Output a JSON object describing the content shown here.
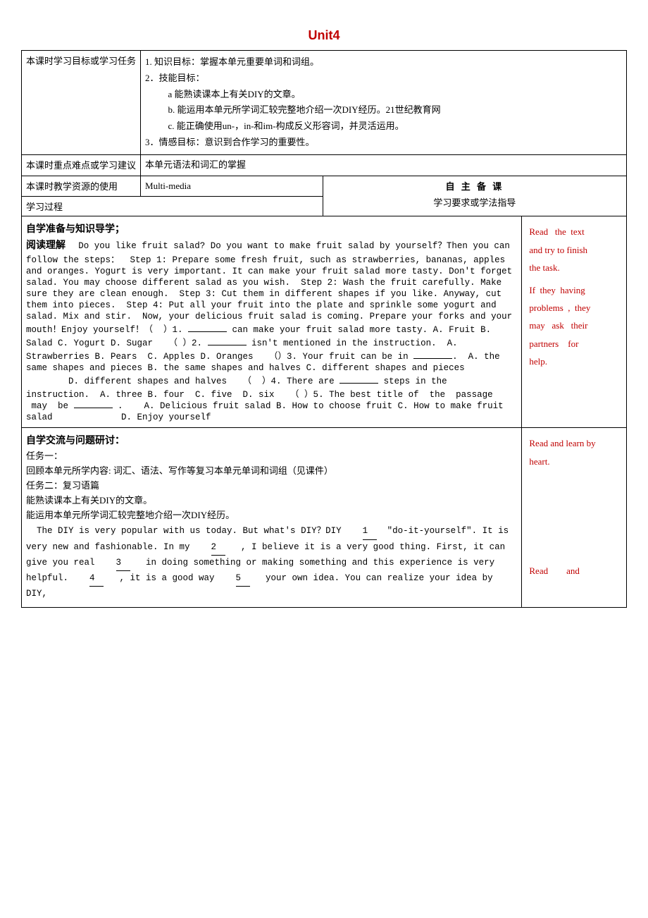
{
  "title": "Unit4",
  "table": {
    "row1": {
      "label": "本课时学习目标或学习任务",
      "content_lines": [
        "1. 知识目标：掌握本单元重要单词和词组。",
        "2．技能目标：",
        "a    能熟读课本上有关DIY的文章。",
        "b.   能运用本单元所学词汇较完整地介绍一次DIY经历。21世纪教育网",
        "c.   能正确使用un-，in-和im-构成反义形容词，并灵活运用。",
        "3．情感目标：意识到合作学习的重要性。"
      ]
    },
    "row2": {
      "label": "本课时重点难点或学习建议",
      "content": "本单元语法和词汇的掌握"
    },
    "row3": {
      "label": "本课时教学资源的使用",
      "content": "Multi-media",
      "right_label": "自 主 备 课",
      "right_sublabel": "学习要求或学法指导"
    },
    "row4": {
      "label": "学习过程"
    },
    "section1_heading": "自学准备与知识导学；",
    "section1_sub": "阅读理解",
    "section1_text": "Do you like fruit salad? Do you want to make fruit salad by yourself？Then you can follow the steps：  Step 1: Prepare some fresh fruit, such as strawberries, bananas, apples and oranges. Yogurt is very important. It can make your fruit salad more tasty. Don't forget salad. You may choose different salad as you wish.  Step 2: Wash the fruit carefully. Make sure they are clean enough.  Step 3: Cut them in different shapes if you like. Anyway, cut them into pieces.  Step 4: Put all your fruit into the plate and sprinkle some yogurt and salad. Mix and stir.  Now, your delicious fruit salad is coming. Prepare your forks and your mouth！Enjoy yourself！（  ）1.         can make your fruit salad more tasty. A. Fruit B. Salad C. Yogurt D. Sugar  （ ）2.         isn't mentioned in the instruction.  A. Strawberries B. Pears  C. Apples D. Oranges  （）3. Your fruit can be in        .  A. the same shapes and pieces B. the same shapes and halves C. different shapes and pieces         D. different shapes and halves  （  ）4. There are         steps in the instruction.  A. three B. four  C. five  D. six  （ ）5. The best title of  the  passage  may  be          .    A. Delicious fruit salad B. How to choose fruit C. How to make fruit salad             D. Enjoy yourself",
    "right1_text": "Read   the  text and try to finish the task.\n\nIf  they  having problems  ,  they may   ask   their partners   for help.",
    "section2_heading": "自学交流与问题研讨：",
    "task1_heading": "任务一：",
    "task1_content": "回顾本单元所学内容: 词汇、语法、写作等复习本单元单词和词组（见课件）",
    "task2_heading": "任务二：复习语篇",
    "task2_line1": "能熟读课本上有关DIY的文章。",
    "task2_line2": "能运用本单元所学词汇较完整地介绍一次DIY经历。",
    "task2_passage": "  The DIY is very popular with us today. But what's DIY？DIY    1    \"do-it-yourself\". It is very new and fashionable. In my    2    , I believe it is a very good thing. First, it can give you real    3    in doing something or making something and this experience is very helpful.    4    , it is a good way    5    your own idea. You can realize your idea by DIY,",
    "right2_text": "Read and learn by heart.",
    "right3_text": "Read   and"
  }
}
